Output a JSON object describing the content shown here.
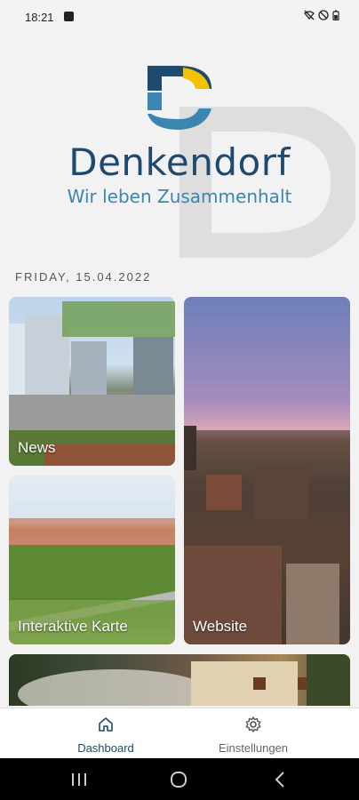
{
  "status_bar": {
    "time": "18:21"
  },
  "brand": {
    "name": "Denkendorf",
    "tagline": "Wir leben Zusammenhalt",
    "colors": {
      "dark": "#1f4a6e",
      "light": "#3b86b0",
      "yellow": "#f2c200"
    }
  },
  "date_label": "FRIDAY, 15.04.2022",
  "tiles": [
    {
      "label": "News"
    },
    {
      "label": "Interaktive Karte"
    },
    {
      "label": "Website"
    }
  ],
  "bottom_nav": {
    "items": [
      {
        "label": "Dashboard",
        "icon": "home-icon",
        "active": true
      },
      {
        "label": "Einstellungen",
        "icon": "gear-icon",
        "active": false
      }
    ]
  },
  "system_nav": {
    "icons": [
      "recents-icon",
      "home-circle-icon",
      "back-icon"
    ]
  }
}
